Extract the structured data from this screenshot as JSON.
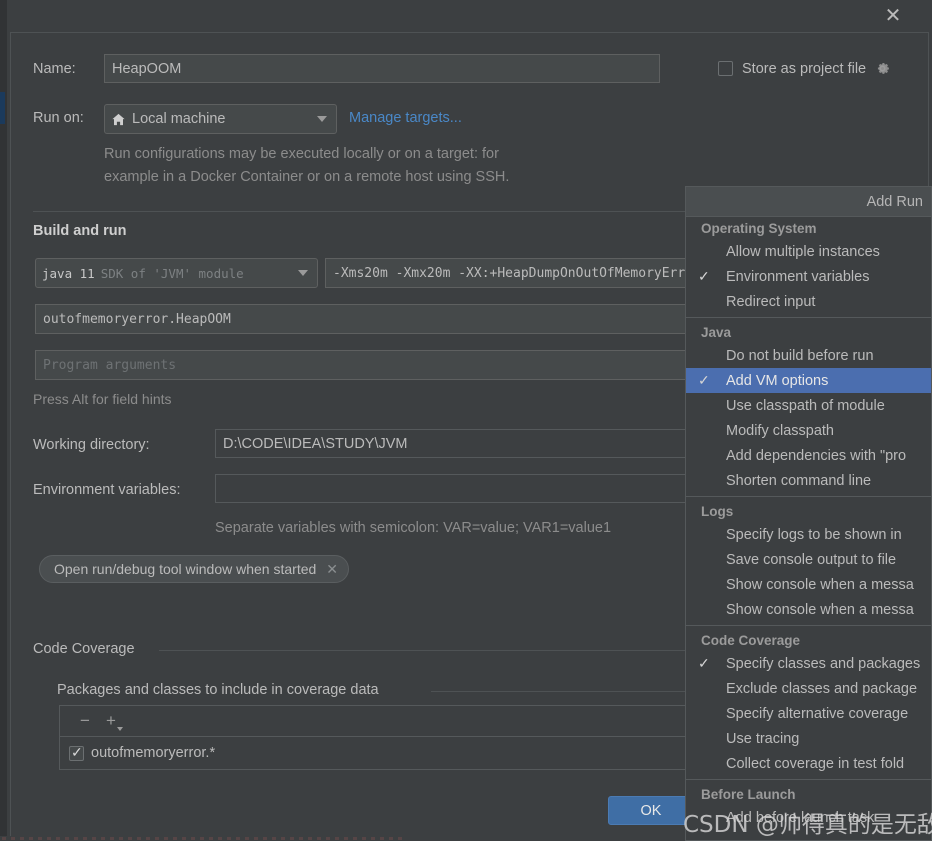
{
  "window": {
    "close_label": "✕"
  },
  "form": {
    "name_label": "Name:",
    "name_value": "HeapOOM",
    "store_as_project_file_label": "Store as project file",
    "run_on_label": "Run on:",
    "run_on_value": "Local machine",
    "manage_targets_link": "Manage targets...",
    "hint_line1": "Run configurations may be executed locally or on a target: for",
    "hint_line2": "example in a Docker Container or on a remote host using SSH.",
    "build_and_run_header": "Build and run",
    "jdk_value_bold": "java 11",
    "jdk_value_dim": "SDK of 'JVM' module",
    "vm_options_value": "-Xms20m -Xmx20m -XX:+HeapDumpOnOutOfMemoryErr",
    "main_class_value": "outofmemoryerror.HeapOOM",
    "program_arguments_placeholder": "Program arguments",
    "field_hints": "Press Alt for field hints",
    "working_directory_label": "Working directory:",
    "working_directory_value": "D:\\CODE\\IDEA\\STUDY\\JVM",
    "environment_variables_label": "Environment variables:",
    "environment_variables_value": "",
    "env_hint": "Separate variables with semicolon: VAR=value; VAR1=value1",
    "open_tool_window_chip": "Open run/debug tool window when started",
    "chip_close": "✕",
    "code_coverage_header": "Code Coverage",
    "coverage_packages_header": "Packages and classes to include in coverage data",
    "coverage_rows": [
      {
        "checked": true,
        "value": "outofmemoryerror.*"
      }
    ],
    "toolbar_remove": "−",
    "toolbar_add": "+"
  },
  "footer": {
    "ok_label": "OK"
  },
  "menu": {
    "header": "Add Run",
    "groups": [
      {
        "title": "Operating System",
        "items": [
          {
            "label": "Allow multiple instances",
            "checked": false,
            "selected": false
          },
          {
            "label": "Environment variables",
            "checked": true,
            "selected": false
          },
          {
            "label": "Redirect input",
            "checked": false,
            "selected": false
          }
        ]
      },
      {
        "title": "Java",
        "items": [
          {
            "label": "Do not build before run",
            "checked": false,
            "selected": false
          },
          {
            "label": "Add VM options",
            "checked": true,
            "selected": true
          },
          {
            "label": "Use classpath of module",
            "checked": false,
            "selected": false
          },
          {
            "label": "Modify classpath",
            "checked": false,
            "selected": false
          },
          {
            "label": "Add dependencies with \"pro",
            "checked": false,
            "selected": false
          },
          {
            "label": "Shorten command line",
            "checked": false,
            "selected": false
          }
        ]
      },
      {
        "title": "Logs",
        "items": [
          {
            "label": "Specify logs to be shown in",
            "checked": false,
            "selected": false
          },
          {
            "label": "Save console output to file",
            "checked": false,
            "selected": false
          },
          {
            "label": "Show console when a messa",
            "checked": false,
            "selected": false
          },
          {
            "label": "Show console when a messa",
            "checked": false,
            "selected": false
          }
        ]
      },
      {
        "title": "Code Coverage",
        "items": [
          {
            "label": "Specify classes and packages",
            "checked": true,
            "selected": false
          },
          {
            "label": "Exclude classes and package",
            "checked": false,
            "selected": false
          },
          {
            "label": "Specify alternative coverage",
            "checked": false,
            "selected": false
          },
          {
            "label": "Use tracing",
            "checked": false,
            "selected": false
          },
          {
            "label": "Collect coverage in test fold",
            "checked": false,
            "selected": false
          }
        ]
      },
      {
        "title": "Before Launch",
        "items": [
          {
            "label": "Add before launch task",
            "checked": false,
            "selected": false
          }
        ]
      }
    ]
  },
  "watermark": {
    "text": "CSDN @帅得真的是无敌了"
  },
  "colors": {
    "dialog_bg": "#3c3f41",
    "field_bg": "#45494a",
    "accent_blue": "#4b6eaf",
    "link_blue": "#4a88c7",
    "ok_button": "#3f6ea5",
    "text": "#bbbbbb",
    "text_dim": "#8c8c8c"
  }
}
